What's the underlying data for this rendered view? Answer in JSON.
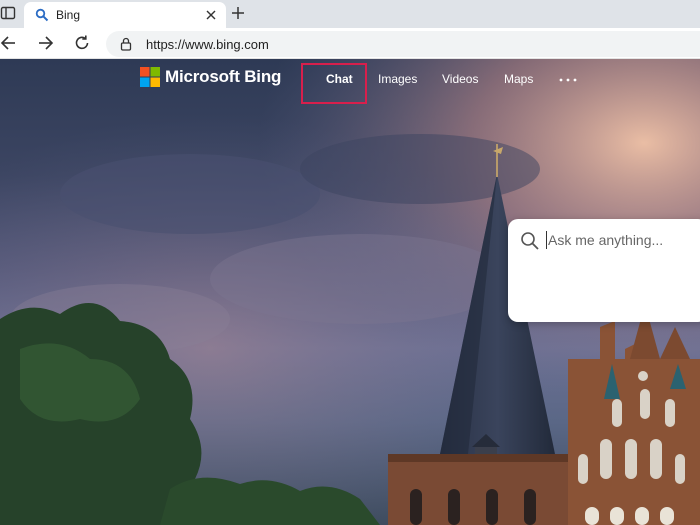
{
  "browser": {
    "tab": {
      "title": "Bing"
    },
    "address": {
      "url": "https://www.bing.com"
    }
  },
  "bing": {
    "brand": "Microsoft Bing",
    "nav": [
      {
        "label": "Chat",
        "highlighted": true
      },
      {
        "label": "Images"
      },
      {
        "label": "Videos"
      },
      {
        "label": "Maps"
      }
    ],
    "search": {
      "placeholder": "Ask me anything..."
    }
  },
  "colors": {
    "highlight_border": "#d81f4c",
    "ms_red": "#f25022",
    "ms_green": "#7fba00",
    "ms_blue": "#00a4ef",
    "ms_yellow": "#ffb900"
  }
}
